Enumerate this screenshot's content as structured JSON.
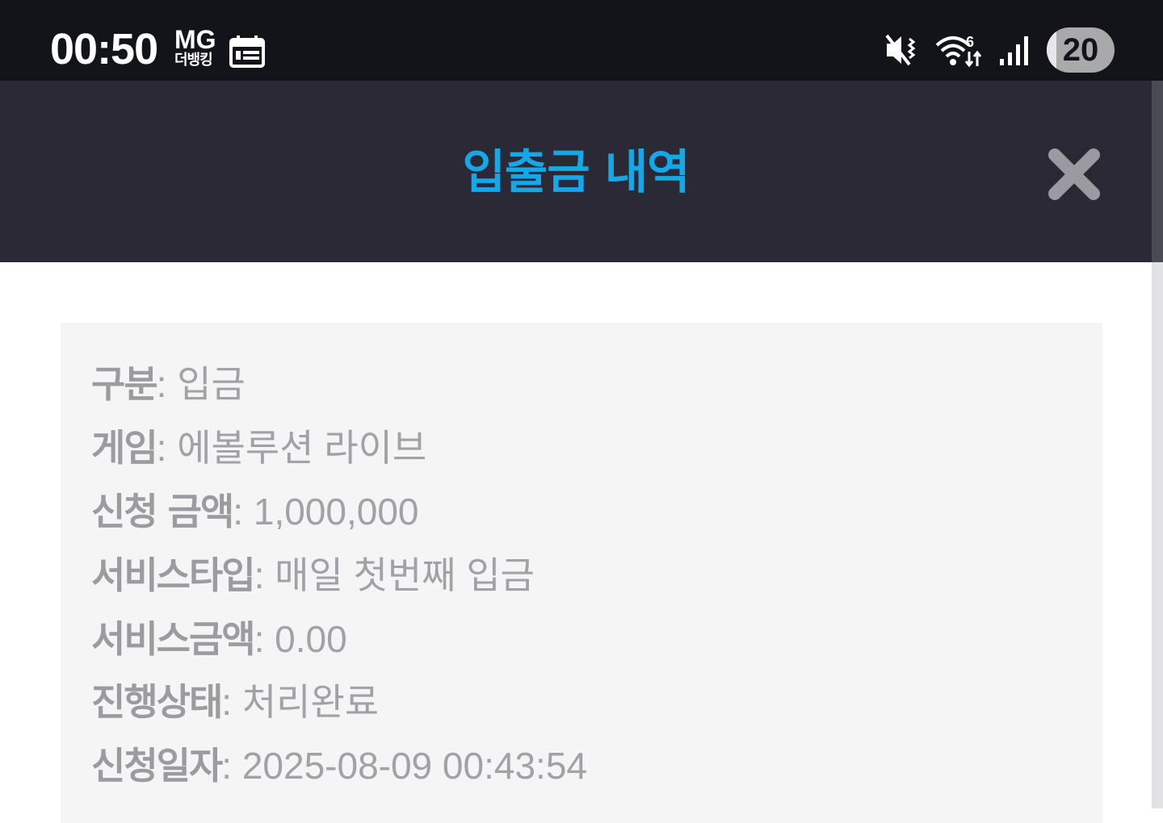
{
  "status_bar": {
    "time": "00:50",
    "carrier_top": "MG",
    "carrier_bottom": "더뱅킹",
    "battery": "20",
    "icons": [
      "calendar-icon",
      "mute-vibrate-icon",
      "wifi-6-icon",
      "signal-bars-icon"
    ]
  },
  "header": {
    "title": "입출금 내역",
    "title_color": "#14a8e8",
    "close_icon": "close-icon"
  },
  "details": [
    {
      "label": "구분",
      "value": "입금"
    },
    {
      "label": "게임",
      "value": "에볼루션 라이브"
    },
    {
      "label": "신청 금액",
      "value": "1,000,000"
    },
    {
      "label": "서비스타입",
      "value": "매일 첫번째 입금"
    },
    {
      "label": "서비스금액",
      "value": "0.00"
    },
    {
      "label": "진행상태",
      "value": "처리완료"
    },
    {
      "label": "신청일자",
      "value": "2025-08-09 00:43:54"
    }
  ]
}
